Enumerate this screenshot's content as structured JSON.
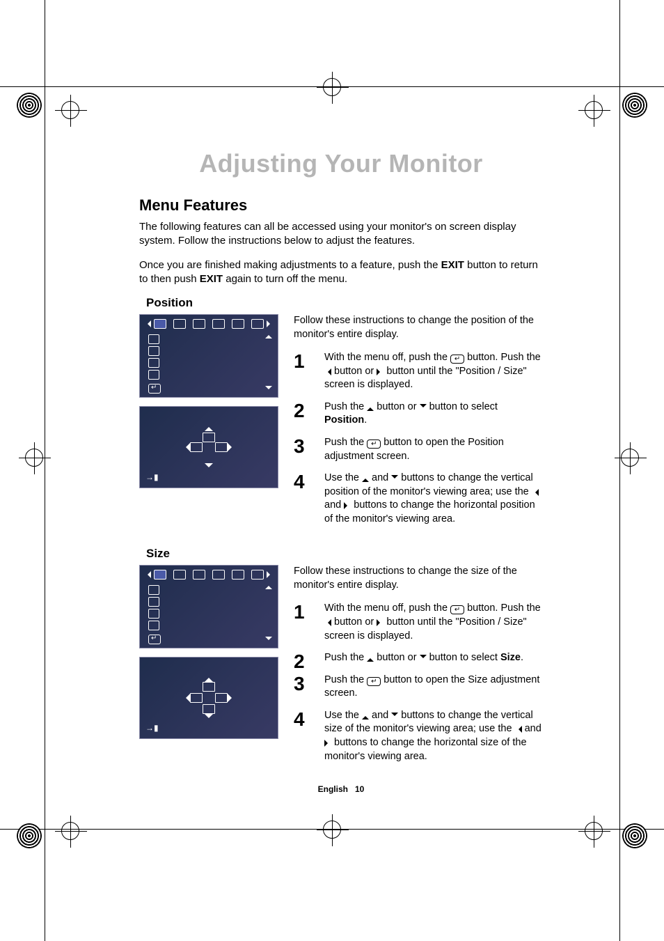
{
  "chapter_title": "Adjusting Your Monitor",
  "section_title": "Menu Features",
  "intro_p1": "The following features can all be accessed using your monitor's on screen display system. Follow the instructions below to adjust the features.",
  "intro_p2_a": "Once you are finished making adjustments to a feature, push the ",
  "intro_p2_exit1": "EXIT",
  "intro_p2_b": " button to return to then push ",
  "intro_p2_exit2": "EXIT",
  "intro_p2_c": " again to turn off the menu.",
  "features": {
    "position": {
      "label": "Position",
      "intro": "Follow these instructions to change the position of the monitor's entire display.",
      "steps": {
        "s1a": "With the menu off, push the ",
        "s1b": " button. Push the ",
        "s1c": " button or ",
        "s1d": " button until the \"Position / Size\" screen is displayed.",
        "s2a": "Push the ",
        "s2b": " button or ",
        "s2c": " button to select ",
        "s2d": "Position",
        "s2e": ".",
        "s3a": "Push the ",
        "s3b": " button to open the Position adjustment screen.",
        "s4a": "Use the ",
        "s4b": " and ",
        "s4c": " buttons to change the vertical position of the monitor's viewing area; use the ",
        "s4d": " and ",
        "s4e": " buttons to change the horizontal position of the monitor's viewing area."
      }
    },
    "size": {
      "label": "Size",
      "intro": "Follow these instructions to change the size of the monitor's entire display.",
      "steps": {
        "s1a": "With the menu off, push the ",
        "s1b": " button. Push the ",
        "s1c": " button or ",
        "s1d": " button until the \"Position / Size\" screen is displayed.",
        "s2a": "Push the ",
        "s2b": " button or ",
        "s2c": " button to select ",
        "s2d": "Size",
        "s2e": ".",
        "s3a": "Push the ",
        "s3b": " button to open the Size adjustment screen.",
        "s4a": "Use the ",
        "s4b": " and ",
        "s4c": " buttons to change the vertical size of the monitor's viewing area; use the ",
        "s4d": " and ",
        "s4e": " buttons to change the horizontal size of the monitor's viewing area."
      }
    }
  },
  "footer": {
    "lang": "English",
    "page": "10"
  }
}
